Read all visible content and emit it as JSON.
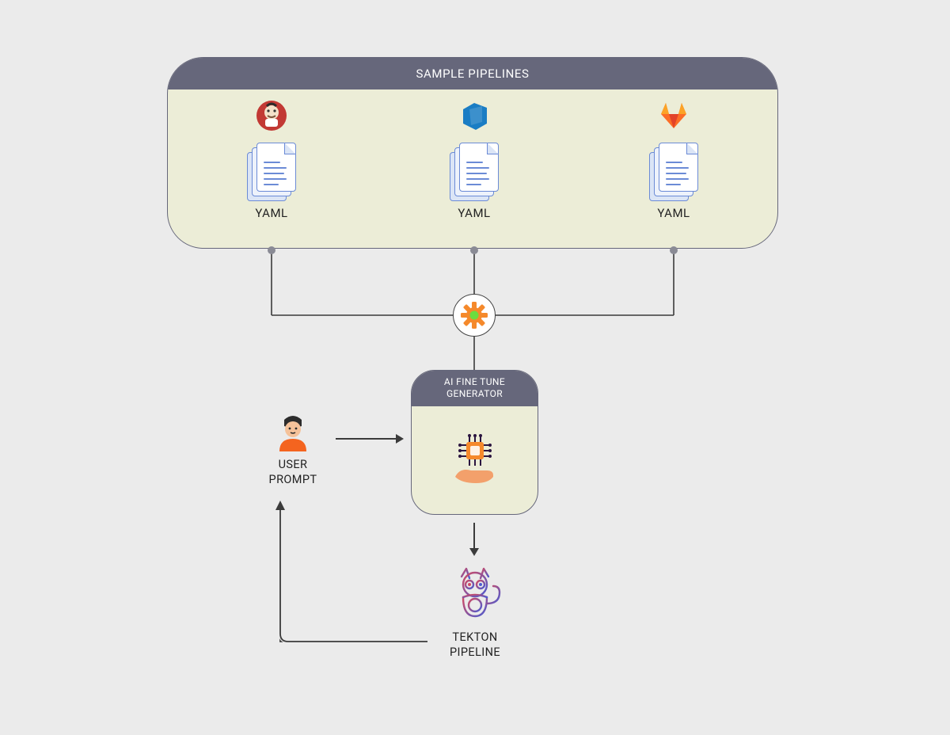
{
  "pipelines": {
    "header": "SAMPLE PIPELINES",
    "items": [
      {
        "logo": "jenkins-icon",
        "file_type": "YAML"
      },
      {
        "logo": "azure-devops-icon",
        "file_type": "YAML"
      },
      {
        "logo": "gitlab-icon",
        "file_type": "YAML"
      }
    ]
  },
  "gear_node": {
    "name": "gear-icon"
  },
  "ai_generator": {
    "title_line1": "AI FINE TUNE",
    "title_line2": "GENERATOR",
    "icon": "ai-chip-hand-icon"
  },
  "user": {
    "icon": "person-icon",
    "label_line1": "USER",
    "label_line2": "PROMPT"
  },
  "tekton": {
    "icon": "tekton-cat-icon",
    "label_line1": "TEKTON",
    "label_line2": "PIPELINE"
  }
}
